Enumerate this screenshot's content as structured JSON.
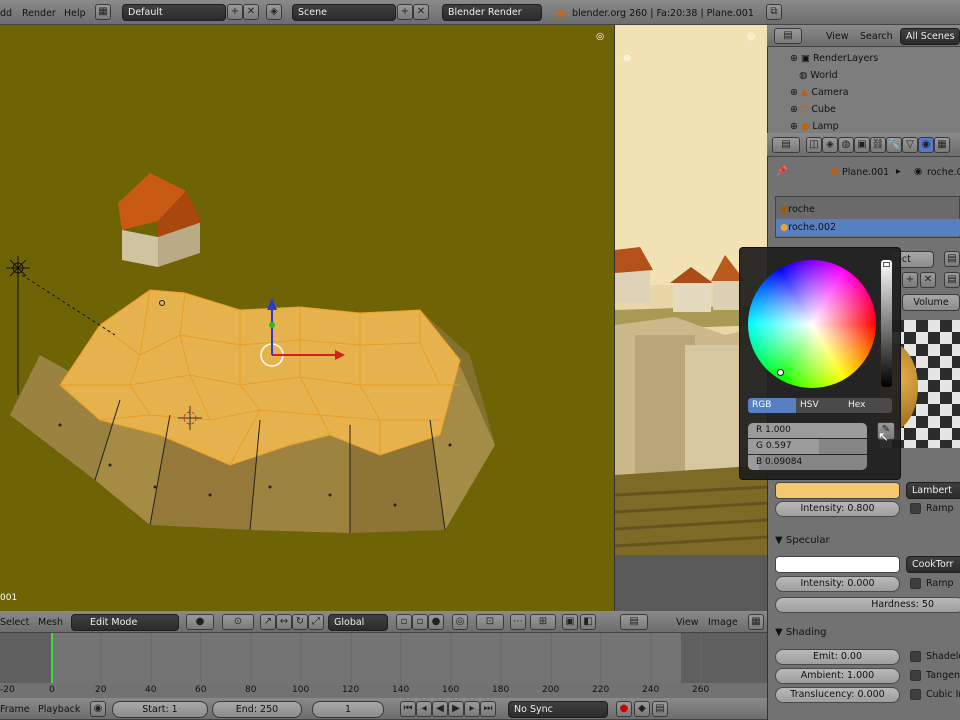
{
  "top_menu": {
    "items": [
      "dd",
      "Render",
      "Help"
    ]
  },
  "screen_layout": {
    "value": "Default"
  },
  "scene": {
    "value": "Scene"
  },
  "render_engine": {
    "value": "Blender Render"
  },
  "info_stats": "blender.org 260 | Fa:20:38 | Plane.001",
  "viewport": {
    "object_label": "001",
    "background": "#6e6405"
  },
  "view3d_header": {
    "select": "Select",
    "mesh": "Mesh",
    "mode": "Edit Mode",
    "orientation": "Global"
  },
  "image_header": {
    "view": "View",
    "image": "Image"
  },
  "outliner": {
    "view": "View",
    "search": "Search",
    "filter": "All Scenes",
    "items": [
      "RenderLayers",
      "World",
      "Camera",
      "Cube",
      "Lamp"
    ]
  },
  "properties": {
    "breadcrumb": {
      "object": "Plane.001",
      "material": "roche.0"
    },
    "material_slots": [
      "roche",
      "roche.002"
    ],
    "select_btn": "ect",
    "volume_tab": "Volume",
    "diffuse": {
      "color": "#f5c86e",
      "shader": "Lambert",
      "intensity": "Intensity: 0.800",
      "ramp": "Ramp"
    },
    "specular": {
      "title": "Specular",
      "color": "#ffffff",
      "shader": "CookTorr",
      "intensity": "Intensity: 0.000",
      "ramp": "Ramp",
      "hardness": "Hardness: 50"
    },
    "shading": {
      "title": "Shading",
      "emit": "Emit: 0.00",
      "ambient": "Ambient: 1.000",
      "translucency": "Translucency: 0.000",
      "shadeless": "Shadeles",
      "tangent": "Tangent",
      "cubic": "Cubic In"
    }
  },
  "color_picker": {
    "tabs": [
      "RGB",
      "HSV",
      "Hex"
    ],
    "r": "R 1.000",
    "g": "G 0.597",
    "b": "B 0.09084",
    "r_value": 1.0,
    "g_value": 0.597,
    "b_value": 0.09084
  },
  "timeline": {
    "ticks": [
      "-20",
      "0",
      "20",
      "40",
      "60",
      "80",
      "100",
      "120",
      "140",
      "160",
      "180",
      "200",
      "220",
      "240",
      "260"
    ],
    "current_frame_marker": 0
  },
  "timeline_footer": {
    "frame": "Frame",
    "playback": "Playback",
    "start": "Start: 1",
    "end": "End: 250",
    "current": "1",
    "sync": "No Sync"
  }
}
